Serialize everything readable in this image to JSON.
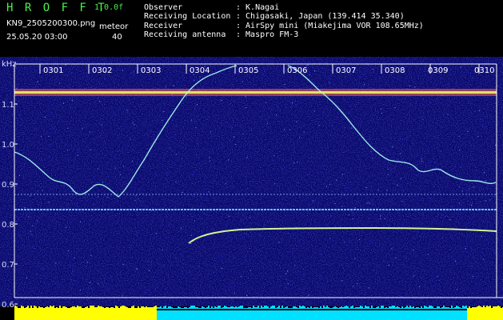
{
  "app": {
    "title": "H R O F F T",
    "version": "1.0.0f",
    "file_name": "KN9_2505200300.png",
    "datetime": "25.05.20 03:00",
    "mode_label": "meteor",
    "mode_value": "40"
  },
  "station": {
    "rows": [
      {
        "label": "Observer",
        "value": ": K.Nagai"
      },
      {
        "label": "Receiving Location",
        "value": ": Chigasaki, Japan (139.414 35.340)"
      },
      {
        "label": "Receiver",
        "value": ": AirSpy mini (Miakejima VOR 108.65MHz)"
      },
      {
        "label": "Receiving antenna",
        "value": ": Maspro FM-3"
      }
    ]
  },
  "spectrogram": {
    "y_unit": "kHz",
    "y_ticks": [
      "1.1",
      "1.0",
      "0.9",
      "0.8",
      "0.7",
      "0.6"
    ],
    "x_ticks": [
      "0301",
      "0302",
      "0303",
      "0304",
      "0305",
      "0306",
      "0307",
      "0308",
      "0309",
      "0310"
    ],
    "colors": {
      "background": "#0a0a6e",
      "noise": "#2b2bd8",
      "bright_noise": "#6fa0ff",
      "trace": "#a8fff0",
      "carrier_band": "#ff6a4a",
      "carrier_core": "#f0ff60",
      "bottom_bar_yellow": "#ffff00",
      "bottom_bar_cyan": "#00e0ff",
      "frame": "#ffffff"
    }
  }
}
